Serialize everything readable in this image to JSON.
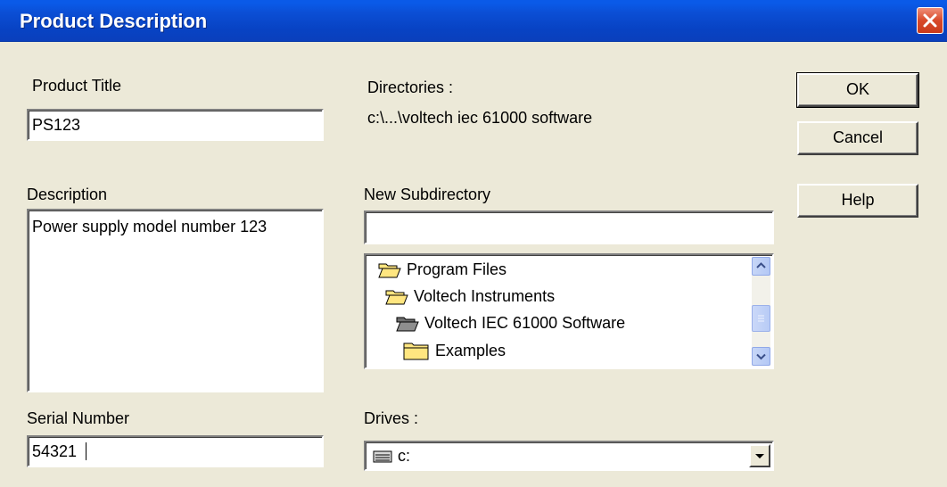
{
  "window": {
    "title": "Product Description"
  },
  "product_title": {
    "label": "Product Title",
    "value": "PS123"
  },
  "description": {
    "label": "Description",
    "value": "Power supply model number 123"
  },
  "serial_number": {
    "label": "Serial Number",
    "value": "54321"
  },
  "directories": {
    "label": "Directories :",
    "path": "c:\\...\\voltech iec 61000 software"
  },
  "new_subdirectory": {
    "label": "New Subdirectory",
    "value": ""
  },
  "tree": {
    "items": [
      {
        "label": "Program Files",
        "icon": "open-folder-icon"
      },
      {
        "label": "Voltech Instruments",
        "icon": "open-folder-icon"
      },
      {
        "label": "Voltech IEC 61000 Software",
        "icon": "open-folder-dark-icon"
      },
      {
        "label": "Examples",
        "icon": "closed-folder-icon"
      }
    ]
  },
  "drives": {
    "label": "Drives :",
    "value": "c:"
  },
  "buttons": {
    "ok": "OK",
    "cancel": "Cancel",
    "help": "Help"
  },
  "colors": {
    "titlebar": "#0a4fd6",
    "dialog_bg": "#ece9d8",
    "folder": "#ffe680",
    "close": "#d8492a"
  }
}
